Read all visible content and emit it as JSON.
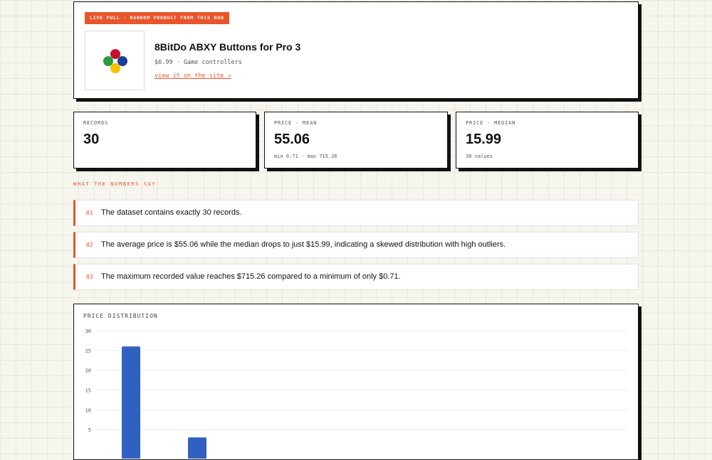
{
  "product": {
    "badge": "LIVE PULL · RANDOM PRODUCT FROM THIS RUN",
    "title": "8BitDo ABXY Buttons for Pro 3",
    "meta": "$6.99 · Game controllers",
    "link": "view it on the site ↗"
  },
  "stats": [
    {
      "label": "RECORDS",
      "value": "30",
      "sub": ""
    },
    {
      "label": "PRICE · MEAN",
      "value": "55.06",
      "sub": "min 0.71 · max 715.26"
    },
    {
      "label": "PRICE · MEDIAN",
      "value": "15.99",
      "sub": "30 values"
    }
  ],
  "insights_label": "WHAT THE NUMBERS SAY",
  "insights": [
    {
      "num": "01",
      "text": "The dataset contains exactly 30 records."
    },
    {
      "num": "02",
      "text": "The average price is $55.06 while the median drops to just $15.99, indicating a skewed distribution with high outliers."
    },
    {
      "num": "03",
      "text": "The maximum recorded value reaches $715.26 compared to a minimum of only $0.71."
    }
  ],
  "chart_title": "PRICE DISTRIBUTION",
  "chart_data": {
    "type": "bar",
    "title": "PRICE DISTRIBUTION",
    "xlabel": "",
    "ylabel": "",
    "ylim": [
      0,
      30
    ],
    "yticks": [
      5,
      10,
      15,
      20,
      25,
      30
    ],
    "grid": true,
    "bar_color": "#3060c0",
    "series": [
      {
        "values": [
          26,
          3
        ]
      }
    ]
  },
  "colors": {
    "accent": "#e8552a",
    "bar": "#3060c0",
    "ink": "#111111"
  }
}
